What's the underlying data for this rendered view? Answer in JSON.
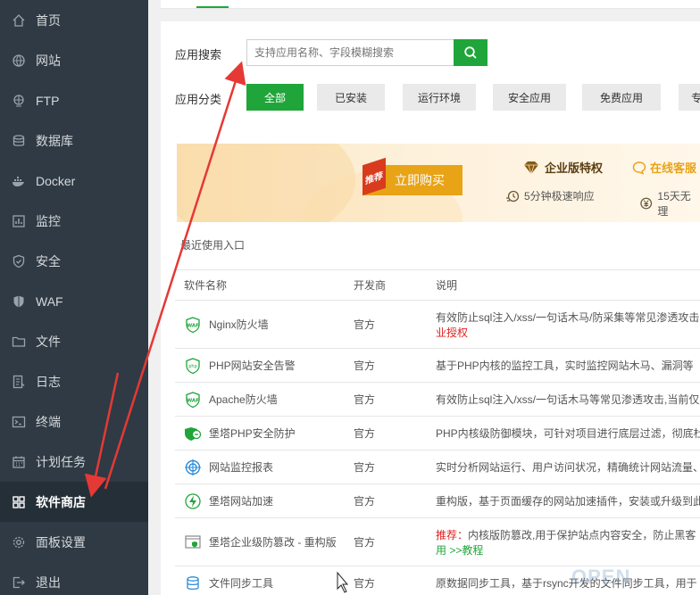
{
  "sidebar": {
    "items": [
      {
        "label": "首页",
        "icon": "home-icon"
      },
      {
        "label": "网站",
        "icon": "globe-icon"
      },
      {
        "label": "FTP",
        "icon": "ftp-icon"
      },
      {
        "label": "数据库",
        "icon": "database-icon"
      },
      {
        "label": "Docker",
        "icon": "docker-icon"
      },
      {
        "label": "监控",
        "icon": "monitor-icon"
      },
      {
        "label": "安全",
        "icon": "shield-icon"
      },
      {
        "label": "WAF",
        "icon": "waf-shield-icon"
      },
      {
        "label": "文件",
        "icon": "folder-icon"
      },
      {
        "label": "日志",
        "icon": "log-icon"
      },
      {
        "label": "终端",
        "icon": "terminal-icon"
      },
      {
        "label": "计划任务",
        "icon": "calendar-icon"
      },
      {
        "label": "软件商店",
        "icon": "grid-icon"
      },
      {
        "label": "面板设置",
        "icon": "gear-icon"
      },
      {
        "label": "退出",
        "icon": "logout-icon"
      }
    ],
    "active_label": "软件商店"
  },
  "search": {
    "label": "应用搜索",
    "placeholder": "支持应用名称、字段模糊搜索"
  },
  "category": {
    "label": "应用分类",
    "buttons": [
      "全部",
      "已安装",
      "运行环境",
      "安全应用",
      "免费应用",
      "专"
    ],
    "active": "全部"
  },
  "banner": {
    "tag": "推荐",
    "buy_label": "立即购买",
    "enterprise_label": "企业版特权",
    "service_label": "在线客服",
    "feature1": "5分钟极速响应",
    "feature2": "15天无理"
  },
  "recent_label": "最近使用入口",
  "table": {
    "headers": [
      "软件名称",
      "开发商",
      "说明"
    ],
    "rows": [
      {
        "name": "Nginx防火墙",
        "icon": "waf-icon",
        "dev": "官方",
        "desc": "有效防止sql注入/xss/一句话木马/防采集等常见渗透攻击",
        "desc2": "业授权",
        "desc2_red": true
      },
      {
        "name": "PHP网站安全告警",
        "icon": "php-alert-icon",
        "dev": "官方",
        "desc": "基于PHP内核的监控工具，实时监控网站木马、漏洞等"
      },
      {
        "name": "Apache防火墙",
        "icon": "waf-icon",
        "dev": "官方",
        "desc": "有效防止sql注入/xss/一句话木马等常见渗透攻击,当前仅"
      },
      {
        "name": "堡塔PHP安全防护",
        "icon": "php-guard-icon",
        "dev": "官方",
        "desc": "PHP内核级防御模块，可针对项目进行底层过滤，彻底杜"
      },
      {
        "name": "网站监控报表",
        "icon": "target-icon",
        "dev": "官方",
        "desc": "实时分析网站运行、用户访问状况，精确统计网站流量、"
      },
      {
        "name": "堡塔网站加速",
        "icon": "bolt-icon",
        "dev": "官方",
        "desc": "重构版，基于页面缓存的网站加速插件，安装或升级到此"
      },
      {
        "name": "堡塔企业级防篡改 - 重构版",
        "icon": "tamper-icon",
        "dev": "官方",
        "desc_prefix": "推荐：",
        "desc": "内核版防篡改,用于保护站点内容安全，防止黑客",
        "desc2": "用 >>教程",
        "desc2_green": true
      },
      {
        "name": "文件同步工具",
        "icon": "sync-db-icon",
        "dev": "官方",
        "desc": "原数据同步工具，基于rsync开发的文件同步工具，用于"
      }
    ]
  },
  "watermark": "OPEN"
}
